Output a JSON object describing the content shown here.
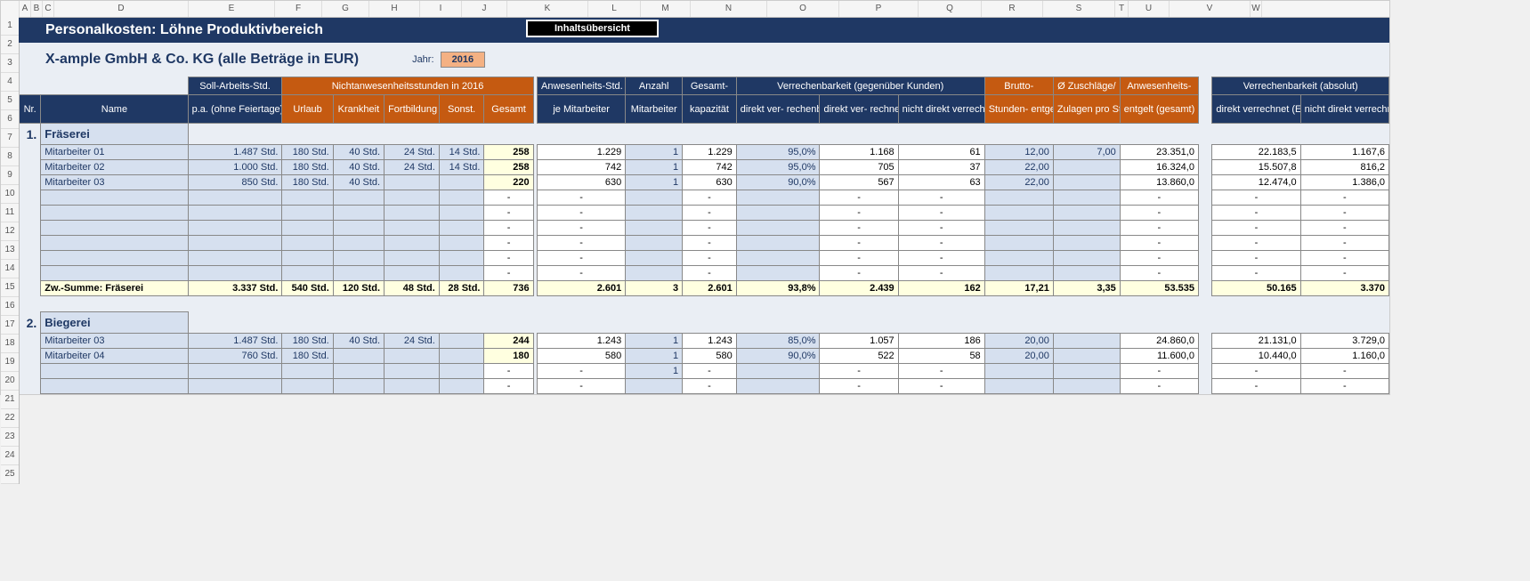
{
  "colLetters": [
    "A",
    "B",
    "C",
    "D",
    "E",
    "F",
    "G",
    "H",
    "I",
    "J",
    "K",
    "L",
    "M",
    "N",
    "O",
    "P",
    "Q",
    "R",
    "S",
    "T",
    "U",
    "V",
    "W"
  ],
  "rowCount": 25,
  "title": "Personalkosten: Löhne Produktivbereich",
  "btnInhalt": "Inhaltsübersicht",
  "subtitle": "X-ample GmbH & Co. KG (alle Beträge in EUR)",
  "jahrLabel": "Jahr:",
  "jahr": "2016",
  "headerTop": {
    "sollArbeit": "Soll-Arbeits-Std.",
    "nichtanw": "Nichtanwesenheitsstunden in 2016",
    "anwesen": "Anwesenheits-Std.",
    "anzahl": "Anzahl",
    "gesamt": "Gesamt-",
    "verrech": "Verrechenbarkeit (gegenüber Kunden)",
    "brutto": "Brutto-",
    "zuschlag": "Ø Zuschläge/",
    "anwEntg": "Anwesenheits-",
    "verrechAbs": "Verrechenbarkeit (absolut)"
  },
  "headerBot": {
    "nr": "Nr.",
    "name": "Name",
    "pa": "p.a. (ohne Feiertage)",
    "urlaub": "Urlaub",
    "krank": "Krankheit",
    "fortb": "Fortbildung",
    "sonst": "Sonst.",
    "gesamt": "Gesamt",
    "jeMit": "je Mitarbeiter",
    "mit": "Mitarbeiter",
    "kapaz": "kapazität",
    "direktPct": "direkt ver-\nrechenbar (%)",
    "direktStd": "direkt ver-\nrechnet (Std.)",
    "nichtDirekt": "nicht direkt\nverrechnet (Std.)",
    "stunden": "Stunden-\nentgelt (EUR)",
    "zulagen": "Zulagen pro\nStd. (EUR)",
    "entgelt": "entgelt (gesamt)",
    "dirVer": "direkt verrechnet\n(EUR)",
    "nichtDir": "nicht direkt\nverrechnet (EUR)"
  },
  "sections": [
    {
      "num": "1.",
      "name": "Fräserei",
      "rows": [
        {
          "name": "Mitarbeiter 01",
          "pa": "1.487 Std.",
          "url": "180 Std.",
          "kr": "40 Std.",
          "fb": "24 Std.",
          "so": "14 Std.",
          "ges": "258",
          "je": "1.229",
          "anz": "1",
          "kap": "1.229",
          "pct": "95,0%",
          "dstd": "1.168",
          "ndstd": "61",
          "hr": "12,00",
          "zul": "7,00",
          "ent": "23.351,0",
          "dv": "22.183,5",
          "ndv": "1.167,6"
        },
        {
          "name": "Mitarbeiter 02",
          "pa": "1.000 Std.",
          "url": "180 Std.",
          "kr": "40 Std.",
          "fb": "24 Std.",
          "so": "14 Std.",
          "ges": "258",
          "je": "742",
          "anz": "1",
          "kap": "742",
          "pct": "95,0%",
          "dstd": "705",
          "ndstd": "37",
          "hr": "22,00",
          "zul": "",
          "ent": "16.324,0",
          "dv": "15.507,8",
          "ndv": "816,2"
        },
        {
          "name": "Mitarbeiter 03",
          "pa": "850 Std.",
          "url": "180 Std.",
          "kr": "40 Std.",
          "fb": "",
          "so": "",
          "ges": "220",
          "je": "630",
          "anz": "1",
          "kap": "630",
          "pct": "90,0%",
          "dstd": "567",
          "ndstd": "63",
          "hr": "22,00",
          "zul": "",
          "ent": "13.860,0",
          "dv": "12.474,0",
          "ndv": "1.386,0"
        }
      ],
      "emptyRows": 6,
      "sum": {
        "name": "Zw.-Summe: Fräserei",
        "pa": "3.337 Std.",
        "url": "540 Std.",
        "kr": "120 Std.",
        "fb": "48 Std.",
        "so": "28 Std.",
        "ges": "736",
        "je": "2.601",
        "anz": "3",
        "kap": "2.601",
        "pct": "93,8%",
        "dstd": "2.439",
        "ndstd": "162",
        "hr": "17,21",
        "zul": "3,35",
        "ent": "53.535",
        "dv": "50.165",
        "ndv": "3.370"
      }
    },
    {
      "num": "2.",
      "name": "Biegerei",
      "rows": [
        {
          "name": "Mitarbeiter 03",
          "pa": "1.487 Std.",
          "url": "180 Std.",
          "kr": "40 Std.",
          "fb": "24 Std.",
          "so": "",
          "ges": "244",
          "je": "1.243",
          "anz": "1",
          "kap": "1.243",
          "pct": "85,0%",
          "dstd": "1.057",
          "ndstd": "186",
          "hr": "20,00",
          "zul": "",
          "ent": "24.860,0",
          "dv": "21.131,0",
          "ndv": "3.729,0"
        },
        {
          "name": "Mitarbeiter 04",
          "pa": "760 Std.",
          "url": "180 Std.",
          "kr": "",
          "fb": "",
          "so": "",
          "ges": "180",
          "je": "580",
          "anz": "1",
          "kap": "580",
          "pct": "90,0%",
          "dstd": "522",
          "ndstd": "58",
          "hr": "20,00",
          "zul": "",
          "ent": "11.600,0",
          "dv": "10.440,0",
          "ndv": "1.160,0"
        }
      ],
      "emptyRows": 2,
      "sum": null
    }
  ],
  "dash": "-"
}
